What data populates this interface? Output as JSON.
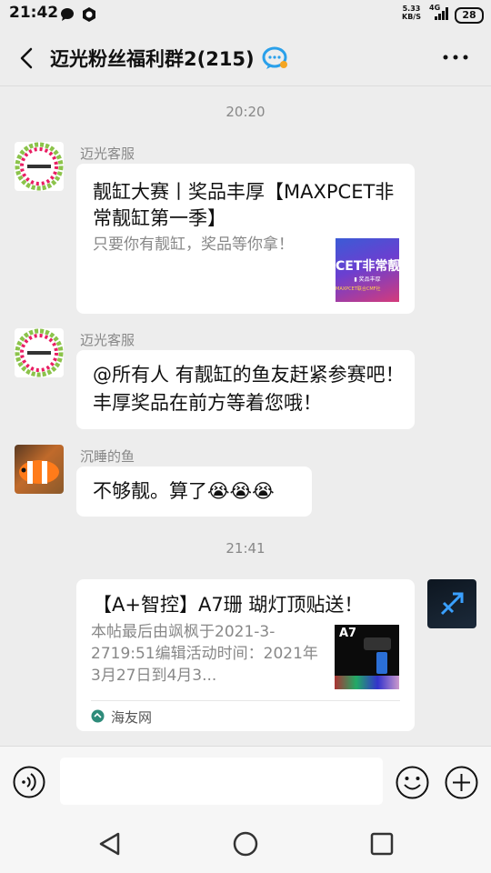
{
  "status_bar": {
    "time": "21:42",
    "net_speed_value": "5.33",
    "net_speed_unit": "KB/S",
    "network": "4G",
    "battery": "28"
  },
  "header": {
    "title": "迈光粉丝福利群2(215)",
    "back_icon": "chevron-left-icon",
    "more_icon": "more-dots-icon"
  },
  "messages": [
    {
      "type": "time",
      "text": "20:20"
    },
    {
      "type": "card",
      "sender": "迈光客服",
      "title": "靓缸大赛丨奖品丰厚【MAXPCET非常靓缸第一季】",
      "description": "只要你有靓缸，奖品等你拿！",
      "thumb_text_1": "CET非常靓",
      "thumb_text_2": "▮ 奖品丰厚",
      "thumb_text_3": "MAXPCET联合CMF社"
    },
    {
      "type": "text",
      "sender": "迈光客服",
      "text": "@所有人  有靓缸的鱼友赶紧参赛吧！丰厚奖品在前方等着您哦！"
    },
    {
      "type": "text",
      "sender": "沉睡的鱼",
      "text": "不够靓。算了😭😭😭"
    },
    {
      "type": "time",
      "text": "21:41"
    },
    {
      "type": "card_self",
      "title": "【A+智控】A7珊 瑚灯顶贴送！",
      "description": "本帖最后由飒枫于2021-3-2719:51编辑活动时间：2021年3月27日到4月3...",
      "thumb_text": "A7",
      "source": "海友网"
    }
  ],
  "input_bar": {
    "voice_icon": "voice-icon",
    "emoji_icon": "emoji-icon",
    "plus_icon": "plus-icon"
  },
  "nav_bar": {
    "back": "triangle-back-icon",
    "home": "circle-home-icon",
    "recent": "square-recent-icon"
  },
  "colors": {
    "background": "#ededed",
    "bubble": "#ffffff",
    "secondary_text": "#888888"
  }
}
